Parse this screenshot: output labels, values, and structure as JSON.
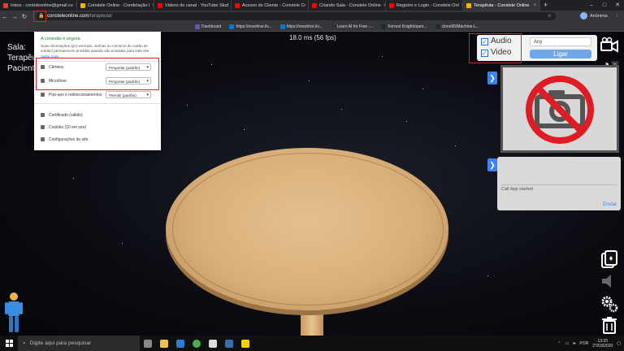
{
  "browser": {
    "tabs": [
      {
        "label": "Inbox - conteleonline@gmail.co",
        "color": "#db4437",
        "active": false
      },
      {
        "label": "Constele Online - Condelação I",
        "color": "#f4b400",
        "active": false
      },
      {
        "label": "Videos do canal - YouTube Stud",
        "color": "#ff0000",
        "active": false
      },
      {
        "label": "Acesso do Cliente - Constele Cr",
        "color": "#ff0000",
        "active": false
      },
      {
        "label": "Criando Sala - Constele Online",
        "color": "#ff0000",
        "active": false
      },
      {
        "label": "Registro e Login - Constele Onl",
        "color": "#ff0000",
        "active": false
      },
      {
        "label": "Terapêuta - Constele Online",
        "color": "#f4b400",
        "active": true
      }
    ],
    "url_host": "consteleonline.com",
    "url_path": "/terapeuta/",
    "account_name": "Anônima",
    "bookmarks": [
      {
        "label": "Dashboard",
        "color": "#6b4fbb"
      },
      {
        "label": "https://onedrive.liv...",
        "color": "#0078d4"
      },
      {
        "label": "https://onedrive.liv...",
        "color": "#0078d4"
      },
      {
        "label": "Learn AI for Free -...",
        "color": "#333333"
      },
      {
        "label": "Forrest Knight/open...",
        "color": "#24292e"
      },
      {
        "label": "clone95/Machine-L...",
        "color": "#24292e"
      }
    ]
  },
  "popup": {
    "title": "A conexão é segura",
    "description": "Suas informações (por exemplo, senhas ou números de cartão de crédito) permanecem privadas quando são enviadas para este site.",
    "learn_more": "Saiba mais",
    "permissions": [
      {
        "icon": "camera-icon",
        "label": "Câmera",
        "value": "Perguntar (padrão)"
      },
      {
        "icon": "microphone-icon",
        "label": "Microfone",
        "value": "Perguntar (padrão)"
      },
      {
        "icon": "popup-icon",
        "label": "Pop-ups e redirecionamentos",
        "value": "Permitir (padrão)"
      }
    ],
    "links": [
      {
        "icon": "certificate-icon",
        "label": "Certificado (válido)"
      },
      {
        "icon": "cookie-icon",
        "label": "Cookies (10 em uso)"
      },
      {
        "icon": "gear-icon",
        "label": "Configurações do site"
      }
    ]
  },
  "scene": {
    "fps": "18.0 ms (56 fps)",
    "side_labels": [
      "Sala:",
      "Terapêu",
      "Pacient"
    ]
  },
  "controls": {
    "audio_label": "Audio",
    "video_label": "Video",
    "device_select": "Any",
    "call_button": "Ligar"
  },
  "chat": {
    "message": "Call App started",
    "send_label": "Enviar"
  },
  "taskbar": {
    "search_placeholder": "Digite aqui para pesquisar",
    "language": "POR",
    "time": "13:20",
    "date": "27/03/2020"
  },
  "colors": {
    "highlight": "#e01b24",
    "call_button": "#6fa8e8",
    "accent_blue": "#3b82f6"
  }
}
